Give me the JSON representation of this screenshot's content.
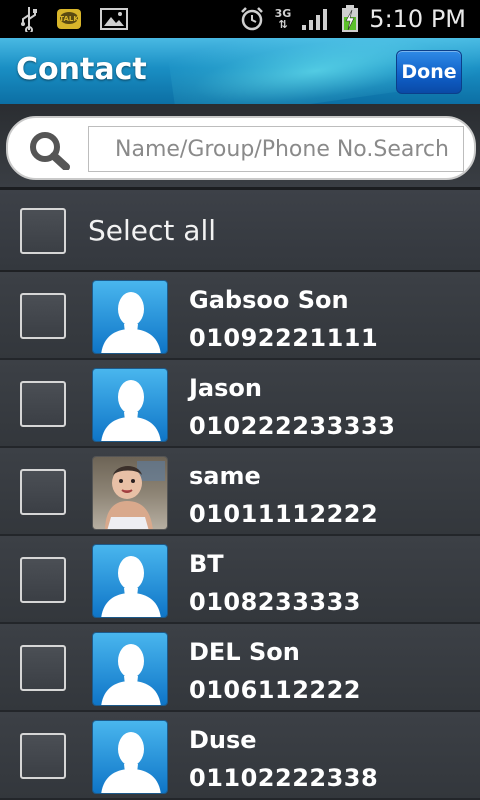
{
  "status_bar": {
    "time": "5:10 PM",
    "network": "3G",
    "icons": [
      "usb-icon",
      "talk-icon",
      "gallery-icon",
      "alarm-icon",
      "signal-icon",
      "battery-charging-icon"
    ]
  },
  "header": {
    "title": "Contact",
    "done_label": "Done"
  },
  "search": {
    "placeholder": "Name/Group/Phone No.Search"
  },
  "select_all": {
    "label": "Select all",
    "checked": false
  },
  "contacts": [
    {
      "name": "Gabsoo Son",
      "phone": "01092221111",
      "avatar": "default-avatar",
      "checked": false
    },
    {
      "name": "Jason",
      "phone": "010222233333",
      "avatar": "default-avatar",
      "checked": false
    },
    {
      "name": "same",
      "phone": "01011112222",
      "avatar": "photo-avatar",
      "checked": false
    },
    {
      "name": "BT",
      "phone": "0108233333",
      "avatar": "default-avatar",
      "checked": false
    },
    {
      "name": "DEL Son",
      "phone": "0106112222",
      "avatar": "default-avatar",
      "checked": false
    },
    {
      "name": "Duse",
      "phone": "01102222338",
      "avatar": "default-avatar",
      "checked": false
    }
  ],
  "colors": {
    "title_bar": "#1a8fc4",
    "done_button": "#0f5ec7",
    "list_background": "#33373c"
  }
}
